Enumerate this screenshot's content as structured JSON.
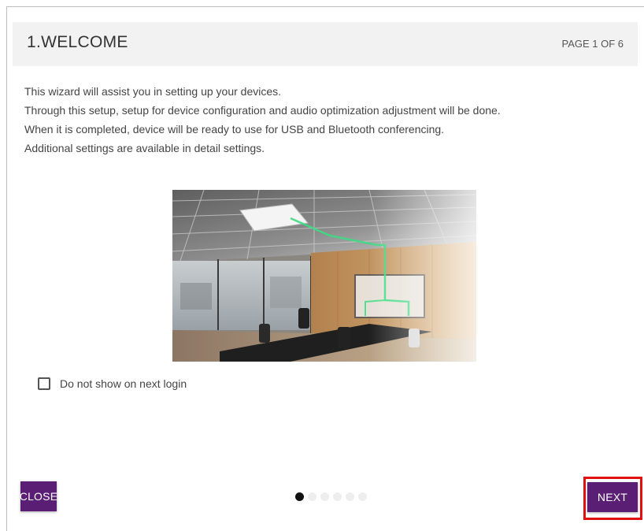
{
  "header": {
    "title": "1.WELCOME",
    "page_indicator": "PAGE 1 OF 6"
  },
  "body": {
    "lines": [
      "This wizard will assist you in setting up your devices.",
      "Through this setup, setup for device configuration and audio optimization adjustment will be done.",
      "When it is completed, device will be ready to use for USB and Bluetooth conferencing.",
      "Additional settings are available in detail settings."
    ]
  },
  "checkbox": {
    "label": "Do not show on next login",
    "checked": false
  },
  "pagination": {
    "current": 1,
    "total": 6
  },
  "footer": {
    "close_label": "CLOSE",
    "next_label": "NEXT"
  },
  "colors": {
    "button": "#5a1f74",
    "highlight": "#e01010",
    "header_bg": "#f2f2f2",
    "light_beam": "#3ddc84"
  },
  "icons": {
    "hero": "conference-room-illustration",
    "checkbox": "checkbox-empty-icon"
  }
}
